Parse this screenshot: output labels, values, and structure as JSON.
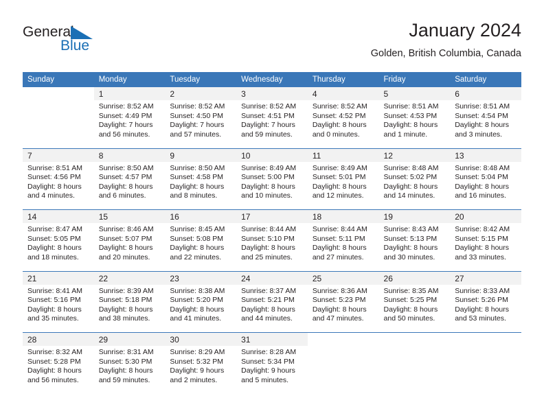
{
  "logo": {
    "word_general": "General",
    "word_blue": "Blue",
    "triangle_color": "#1a6fb5"
  },
  "header": {
    "title": "January 2024",
    "subtitle": "Golden, British Columbia, Canada"
  },
  "theme": {
    "header_bg": "#3a77b8",
    "daynum_bg": "#f2f2f2",
    "text": "#231f20"
  },
  "weekday_headers": [
    "Sunday",
    "Monday",
    "Tuesday",
    "Wednesday",
    "Thursday",
    "Friday",
    "Saturday"
  ],
  "weeks": [
    [
      {
        "day": "",
        "lines": [
          "",
          "",
          "",
          ""
        ]
      },
      {
        "day": "1",
        "lines": [
          "Sunrise: 8:52 AM",
          "Sunset: 4:49 PM",
          "Daylight: 7 hours",
          "and 56 minutes."
        ]
      },
      {
        "day": "2",
        "lines": [
          "Sunrise: 8:52 AM",
          "Sunset: 4:50 PM",
          "Daylight: 7 hours",
          "and 57 minutes."
        ]
      },
      {
        "day": "3",
        "lines": [
          "Sunrise: 8:52 AM",
          "Sunset: 4:51 PM",
          "Daylight: 7 hours",
          "and 59 minutes."
        ]
      },
      {
        "day": "4",
        "lines": [
          "Sunrise: 8:52 AM",
          "Sunset: 4:52 PM",
          "Daylight: 8 hours",
          "and 0 minutes."
        ]
      },
      {
        "day": "5",
        "lines": [
          "Sunrise: 8:51 AM",
          "Sunset: 4:53 PM",
          "Daylight: 8 hours",
          "and 1 minute."
        ]
      },
      {
        "day": "6",
        "lines": [
          "Sunrise: 8:51 AM",
          "Sunset: 4:54 PM",
          "Daylight: 8 hours",
          "and 3 minutes."
        ]
      }
    ],
    [
      {
        "day": "7",
        "lines": [
          "Sunrise: 8:51 AM",
          "Sunset: 4:56 PM",
          "Daylight: 8 hours",
          "and 4 minutes."
        ]
      },
      {
        "day": "8",
        "lines": [
          "Sunrise: 8:50 AM",
          "Sunset: 4:57 PM",
          "Daylight: 8 hours",
          "and 6 minutes."
        ]
      },
      {
        "day": "9",
        "lines": [
          "Sunrise: 8:50 AM",
          "Sunset: 4:58 PM",
          "Daylight: 8 hours",
          "and 8 minutes."
        ]
      },
      {
        "day": "10",
        "lines": [
          "Sunrise: 8:49 AM",
          "Sunset: 5:00 PM",
          "Daylight: 8 hours",
          "and 10 minutes."
        ]
      },
      {
        "day": "11",
        "lines": [
          "Sunrise: 8:49 AM",
          "Sunset: 5:01 PM",
          "Daylight: 8 hours",
          "and 12 minutes."
        ]
      },
      {
        "day": "12",
        "lines": [
          "Sunrise: 8:48 AM",
          "Sunset: 5:02 PM",
          "Daylight: 8 hours",
          "and 14 minutes."
        ]
      },
      {
        "day": "13",
        "lines": [
          "Sunrise: 8:48 AM",
          "Sunset: 5:04 PM",
          "Daylight: 8 hours",
          "and 16 minutes."
        ]
      }
    ],
    [
      {
        "day": "14",
        "lines": [
          "Sunrise: 8:47 AM",
          "Sunset: 5:05 PM",
          "Daylight: 8 hours",
          "and 18 minutes."
        ]
      },
      {
        "day": "15",
        "lines": [
          "Sunrise: 8:46 AM",
          "Sunset: 5:07 PM",
          "Daylight: 8 hours",
          "and 20 minutes."
        ]
      },
      {
        "day": "16",
        "lines": [
          "Sunrise: 8:45 AM",
          "Sunset: 5:08 PM",
          "Daylight: 8 hours",
          "and 22 minutes."
        ]
      },
      {
        "day": "17",
        "lines": [
          "Sunrise: 8:44 AM",
          "Sunset: 5:10 PM",
          "Daylight: 8 hours",
          "and 25 minutes."
        ]
      },
      {
        "day": "18",
        "lines": [
          "Sunrise: 8:44 AM",
          "Sunset: 5:11 PM",
          "Daylight: 8 hours",
          "and 27 minutes."
        ]
      },
      {
        "day": "19",
        "lines": [
          "Sunrise: 8:43 AM",
          "Sunset: 5:13 PM",
          "Daylight: 8 hours",
          "and 30 minutes."
        ]
      },
      {
        "day": "20",
        "lines": [
          "Sunrise: 8:42 AM",
          "Sunset: 5:15 PM",
          "Daylight: 8 hours",
          "and 33 minutes."
        ]
      }
    ],
    [
      {
        "day": "21",
        "lines": [
          "Sunrise: 8:41 AM",
          "Sunset: 5:16 PM",
          "Daylight: 8 hours",
          "and 35 minutes."
        ]
      },
      {
        "day": "22",
        "lines": [
          "Sunrise: 8:39 AM",
          "Sunset: 5:18 PM",
          "Daylight: 8 hours",
          "and 38 minutes."
        ]
      },
      {
        "day": "23",
        "lines": [
          "Sunrise: 8:38 AM",
          "Sunset: 5:20 PM",
          "Daylight: 8 hours",
          "and 41 minutes."
        ]
      },
      {
        "day": "24",
        "lines": [
          "Sunrise: 8:37 AM",
          "Sunset: 5:21 PM",
          "Daylight: 8 hours",
          "and 44 minutes."
        ]
      },
      {
        "day": "25",
        "lines": [
          "Sunrise: 8:36 AM",
          "Sunset: 5:23 PM",
          "Daylight: 8 hours",
          "and 47 minutes."
        ]
      },
      {
        "day": "26",
        "lines": [
          "Sunrise: 8:35 AM",
          "Sunset: 5:25 PM",
          "Daylight: 8 hours",
          "and 50 minutes."
        ]
      },
      {
        "day": "27",
        "lines": [
          "Sunrise: 8:33 AM",
          "Sunset: 5:26 PM",
          "Daylight: 8 hours",
          "and 53 minutes."
        ]
      }
    ],
    [
      {
        "day": "28",
        "lines": [
          "Sunrise: 8:32 AM",
          "Sunset: 5:28 PM",
          "Daylight: 8 hours",
          "and 56 minutes."
        ]
      },
      {
        "day": "29",
        "lines": [
          "Sunrise: 8:31 AM",
          "Sunset: 5:30 PM",
          "Daylight: 8 hours",
          "and 59 minutes."
        ]
      },
      {
        "day": "30",
        "lines": [
          "Sunrise: 8:29 AM",
          "Sunset: 5:32 PM",
          "Daylight: 9 hours",
          "and 2 minutes."
        ]
      },
      {
        "day": "31",
        "lines": [
          "Sunrise: 8:28 AM",
          "Sunset: 5:34 PM",
          "Daylight: 9 hours",
          "and 5 minutes."
        ]
      },
      {
        "day": "",
        "lines": [
          "",
          "",
          "",
          ""
        ]
      },
      {
        "day": "",
        "lines": [
          "",
          "",
          "",
          ""
        ]
      },
      {
        "day": "",
        "lines": [
          "",
          "",
          "",
          ""
        ]
      }
    ]
  ]
}
